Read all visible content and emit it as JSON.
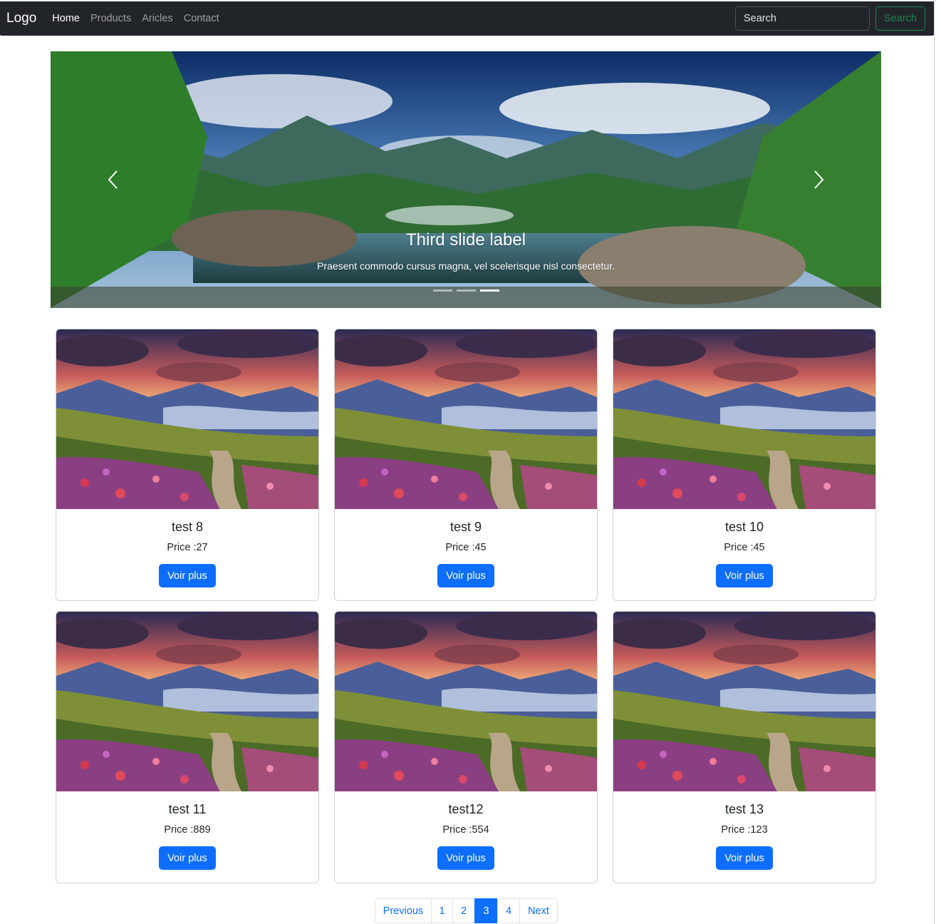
{
  "navbar": {
    "brand": "Logo",
    "links": [
      {
        "label": "Home",
        "active": true
      },
      {
        "label": "Products",
        "active": false
      },
      {
        "label": "Aricles",
        "active": false
      },
      {
        "label": "Contact",
        "active": false
      }
    ],
    "search": {
      "placeholder": "Search",
      "button_label": "Search"
    }
  },
  "carousel": {
    "caption_title": "Third slide label",
    "caption_text": "Praesent commodo cursus magna, vel scelerisque nisl consectetur.",
    "slide_count": 3,
    "active_index": 2
  },
  "products": [
    {
      "title": "test 8",
      "price": "Price :27",
      "button": "Voir plus"
    },
    {
      "title": "test 9",
      "price": "Price :45",
      "button": "Voir plus"
    },
    {
      "title": "test 10",
      "price": "Price :45",
      "button": "Voir plus"
    },
    {
      "title": "test 11",
      "price": "Price :889",
      "button": "Voir plus"
    },
    {
      "title": "test12",
      "price": "Price :554",
      "button": "Voir plus"
    },
    {
      "title": "test 13",
      "price": "Price :123",
      "button": "Voir plus"
    }
  ],
  "pagination": {
    "previous": "Previous",
    "pages": [
      "1",
      "2",
      "3",
      "4"
    ],
    "active_page": "3",
    "next": "Next"
  },
  "colors": {
    "navbar_bg": "#212529",
    "primary": "#0d6efd",
    "success": "#198754"
  }
}
